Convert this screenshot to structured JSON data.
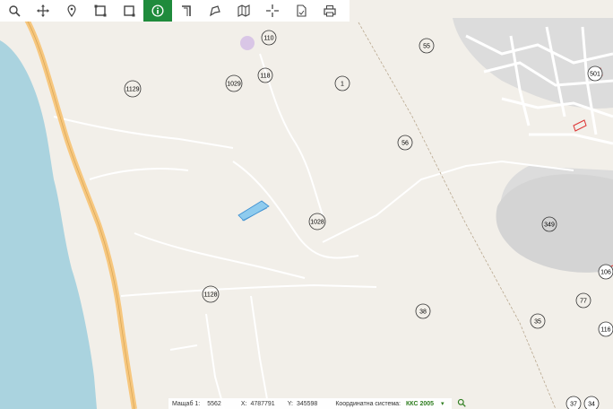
{
  "toolbar": {
    "tools": [
      {
        "name": "zoom-icon",
        "active": false
      },
      {
        "name": "pan-icon",
        "active": false
      },
      {
        "name": "pin-icon",
        "active": false
      },
      {
        "name": "square-select-icon",
        "active": false
      },
      {
        "name": "rect-select-icon",
        "active": false
      },
      {
        "name": "info-icon",
        "active": true
      },
      {
        "name": "measure-line-icon",
        "active": false
      },
      {
        "name": "measure-area-icon",
        "active": false
      },
      {
        "name": "map-layers-icon",
        "active": false
      },
      {
        "name": "crosshair-icon",
        "active": false
      },
      {
        "name": "document-icon",
        "active": false
      },
      {
        "name": "print-icon",
        "active": false
      }
    ]
  },
  "parcels": [
    "110",
    "55",
    "501",
    "1129",
    "1029",
    "118",
    "1",
    "56",
    "1028",
    "349",
    "106",
    "1128",
    "38",
    "35",
    "77",
    "116",
    "37",
    "34"
  ],
  "status": {
    "scale_label": "Мащаб 1:",
    "scale_value": "5562",
    "x_label": "X:",
    "x_value": "4787791",
    "y_label": "Y:",
    "y_value": "345598",
    "crs_label": "Координатна система:",
    "crs_value": "ККС 2005"
  },
  "colors": {
    "land": "#f2efe9",
    "water": "#aad3df",
    "road_major": "#f7c77e",
    "highlight": "#8ecbee",
    "builtup": "#d9d9d9"
  }
}
